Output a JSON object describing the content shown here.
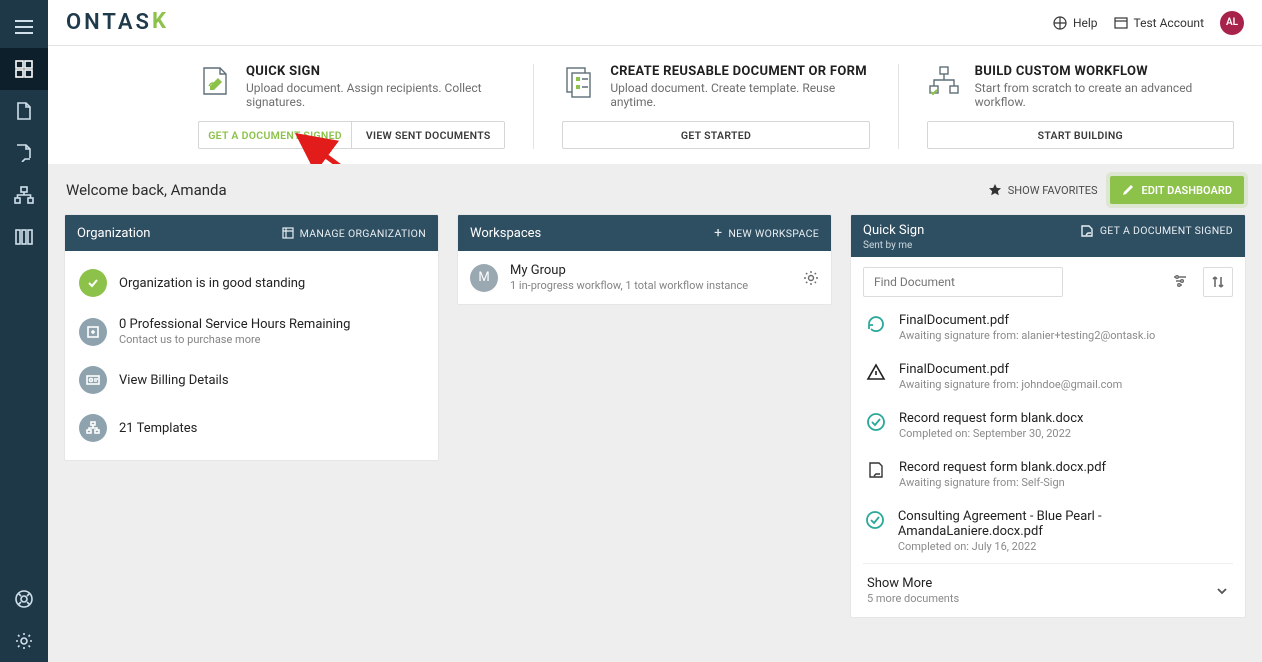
{
  "brand": {
    "name": "ONTAS",
    "accent_letter": "K"
  },
  "topbar": {
    "help_label": "Help",
    "account_label": "Test Account",
    "avatar_initials": "AL"
  },
  "cards": {
    "quick_sign": {
      "title": "QUICK SIGN",
      "subtitle": "Upload document. Assign recipients. Collect signatures.",
      "btn_primary": "GET A DOCUMENT SIGNED",
      "btn_secondary": "VIEW SENT DOCUMENTS"
    },
    "reusable": {
      "title": "CREATE REUSABLE DOCUMENT OR FORM",
      "subtitle": "Upload document. Create template. Reuse anytime.",
      "btn": "GET STARTED"
    },
    "workflow": {
      "title": "BUILD CUSTOM WORKFLOW",
      "subtitle": "Start from scratch to create an advanced workflow.",
      "btn": "START BUILDING"
    }
  },
  "welcome": {
    "greeting": "Welcome back, Amanda",
    "show_favorites": "SHOW FAVORITES",
    "edit_dashboard": "EDIT DASHBOARD"
  },
  "organization": {
    "header": "Organization",
    "manage_label": "MANAGE ORGANIZATION",
    "items": [
      {
        "icon": "check",
        "title": "Organization is in good standing",
        "subtitle": ""
      },
      {
        "icon": "hours",
        "title": "0 Professional Service Hours Remaining",
        "subtitle": "Contact us to purchase more"
      },
      {
        "icon": "billing",
        "title": "View Billing Details",
        "subtitle": ""
      },
      {
        "icon": "templates",
        "title": "21 Templates",
        "subtitle": ""
      }
    ]
  },
  "workspaces": {
    "header": "Workspaces",
    "new_label": "NEW WORKSPACE",
    "items": [
      {
        "badge": "M",
        "title": "My Group",
        "subtitle": "1 in-progress workflow, 1 total workflow instance"
      }
    ]
  },
  "quick_sign_panel": {
    "header": "Quick Sign",
    "action_label": "GET A DOCUMENT SIGNED",
    "sent_by": "Sent by me",
    "search_placeholder": "Find Document",
    "docs": [
      {
        "status": "awaiting",
        "title": "FinalDocument.pdf",
        "subtitle": "Awaiting signature from: alanier+testing2@ontask.io"
      },
      {
        "status": "attention",
        "title": "FinalDocument.pdf",
        "subtitle": "Awaiting signature from: johndoe@gmail.com"
      },
      {
        "status": "done",
        "title": "Record request form blank.docx",
        "subtitle": "Completed on: September 30, 2022"
      },
      {
        "status": "awaiting-plain",
        "title": "Record request form blank.docx.pdf",
        "subtitle": "Awaiting signature from: Self-Sign"
      },
      {
        "status": "done",
        "title": "Consulting Agreement - Blue Pearl - AmandaLaniere.docx.pdf",
        "subtitle": "Completed on: July 16, 2022"
      }
    ],
    "show_more": {
      "title": "Show More",
      "subtitle": "5 more documents"
    }
  },
  "colors": {
    "accent_green": "#8cc24a",
    "header_blue": "#2e4e61",
    "rail": "#1e3848"
  }
}
